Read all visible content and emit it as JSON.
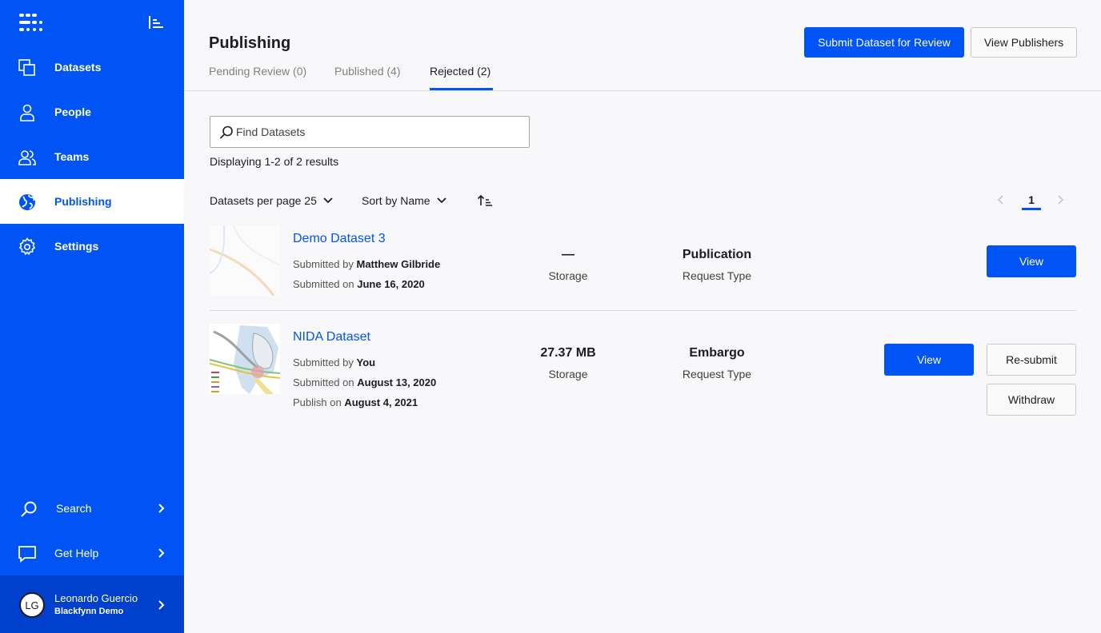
{
  "sidebar": {
    "items": [
      {
        "label": "Datasets",
        "icon": "datasets-icon"
      },
      {
        "label": "People",
        "icon": "person-icon"
      },
      {
        "label": "Teams",
        "icon": "teams-icon"
      },
      {
        "label": "Publishing",
        "icon": "globe-icon"
      },
      {
        "label": "Settings",
        "icon": "gear-icon"
      }
    ],
    "bottom_items": [
      {
        "label": "Search",
        "icon": "search-icon"
      },
      {
        "label": "Get Help",
        "icon": "chat-icon"
      }
    ],
    "user": {
      "initials": "LG",
      "name": "Leonardo Guercio",
      "org": "Blackfynn Demo"
    }
  },
  "header": {
    "title": "Publishing",
    "tabs": [
      {
        "label": "Pending Review (0)"
      },
      {
        "label": "Published (4)"
      },
      {
        "label": "Rejected (2)"
      }
    ],
    "submit_label": "Submit Dataset for Review",
    "view_publishers_label": "View Publishers"
  },
  "main": {
    "search_placeholder": "Find Datasets",
    "results_text": "Displaying 1-2 of 2 results",
    "per_page_label": "Datasets per page 25",
    "sort_label": "Sort by Name",
    "current_page": "1",
    "datasets": [
      {
        "title": "Demo Dataset 3",
        "submitted_by_label": "Submitted by",
        "submitted_by": "Matthew Gilbride",
        "submitted_on_label": "Submitted on",
        "submitted_on": "June 16, 2020",
        "storage_value": "—",
        "storage_label": "Storage",
        "request_type_value": "Publication",
        "request_type_label": "Request Type",
        "view_label": "View"
      },
      {
        "title": "NIDA Dataset",
        "submitted_by_label": "Submitted by",
        "submitted_by": "You",
        "submitted_on_label": "Submitted on",
        "submitted_on": "August 13, 2020",
        "publish_on_label": "Publish on",
        "publish_on": "August 4, 2021",
        "storage_value": "27.37 MB",
        "storage_label": "Storage",
        "request_type_value": "Embargo",
        "request_type_label": "Request Type",
        "view_label": "View",
        "resubmit_label": "Re-submit",
        "withdraw_label": "Withdraw"
      }
    ]
  },
  "colors": {
    "accent": "#0054f5",
    "sidebar_bg": "#0054f5",
    "user_block_bg": "#0040cc"
  }
}
